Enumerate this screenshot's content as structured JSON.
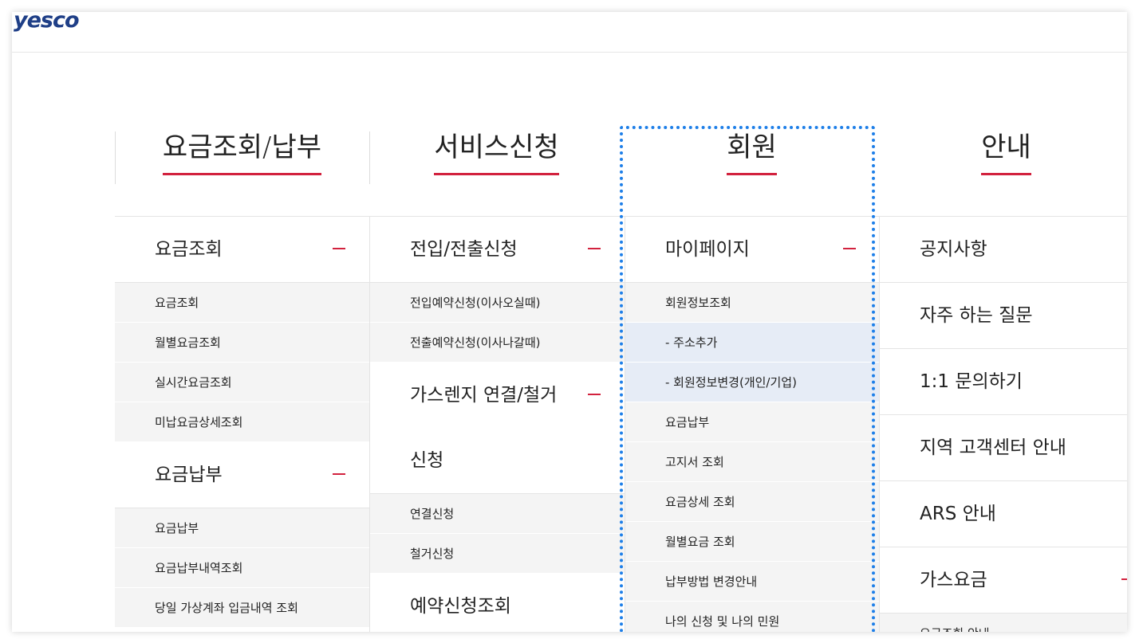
{
  "logo": "yesco",
  "columns": [
    {
      "title": "요금조회/납부",
      "groups": [
        {
          "label": "요금조회",
          "items": [
            "요금조회",
            "월별요금조회",
            "실시간요금조회",
            "미납요금상세조회"
          ]
        },
        {
          "label": "요금납부",
          "items": [
            "요금납부",
            "요금납부내역조회",
            "당일 가상계좌 입금내역 조회"
          ]
        }
      ]
    },
    {
      "title": "서비스신청",
      "groups": [
        {
          "label": "전입/전출신청",
          "items": [
            "전입예약신청(이사오실때)",
            "전출예약신청(이사나갈때)"
          ]
        },
        {
          "label_line1": "가스렌지 연결/철거",
          "label_line2": "신청",
          "items": [
            "연결신청",
            "철거신청"
          ]
        },
        {
          "label": "예약신청조회"
        }
      ]
    },
    {
      "title": "회원",
      "groups": [
        {
          "label": "마이페이지",
          "items": [
            "회원정보조회",
            "- 주소추가",
            "- 회원정보변경(개인/기업)",
            "요금납부",
            "고지서 조회",
            "요금상세 조회",
            "월별요금 조회",
            "납부방법 변경안내",
            "나의 신청 및 나의 민원"
          ]
        }
      ]
    },
    {
      "title": "안내",
      "items": [
        "공지사항",
        "자주 하는 질문",
        "1:1 문의하기",
        "지역 고객센터 안내",
        "ARS 안내",
        "가스요금"
      ],
      "partial_sub": "요금조회 안내"
    }
  ]
}
